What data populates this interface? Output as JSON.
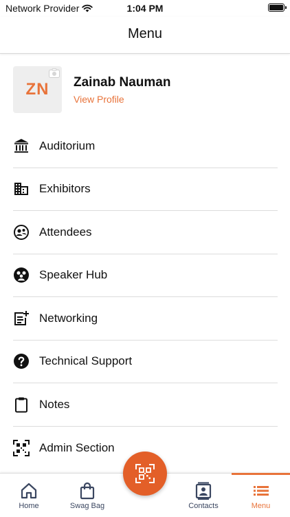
{
  "status_bar": {
    "carrier": "Network Provider",
    "time": "1:04 PM"
  },
  "header": {
    "title": "Menu"
  },
  "profile": {
    "initials": "ZN",
    "name": "Zainab Nauman",
    "link_label": "View Profile"
  },
  "menu": {
    "items": [
      {
        "label": "Auditorium",
        "icon": "auditorium-icon"
      },
      {
        "label": "Exhibitors",
        "icon": "exhibitors-icon"
      },
      {
        "label": "Attendees",
        "icon": "attendees-icon"
      },
      {
        "label": "Speaker Hub",
        "icon": "speaker-hub-icon"
      },
      {
        "label": "Networking",
        "icon": "networking-icon"
      },
      {
        "label": "Technical Support",
        "icon": "help-icon"
      },
      {
        "label": "Notes",
        "icon": "clipboard-icon"
      },
      {
        "label": "Admin Section",
        "icon": "qr-code-icon"
      }
    ]
  },
  "tab_bar": {
    "tabs": [
      {
        "label": "Home",
        "icon": "home-icon"
      },
      {
        "label": "Swag Bag",
        "icon": "bag-icon"
      },
      {
        "label": "Contacts",
        "icon": "contacts-icon"
      },
      {
        "label": "Menu",
        "icon": "menu-icon",
        "active": true
      }
    ],
    "scan_button_icon": "qr-scan-icon"
  },
  "colors": {
    "accent": "#e8733a",
    "fab": "#e35f28",
    "tab_text": "#3a4660"
  }
}
